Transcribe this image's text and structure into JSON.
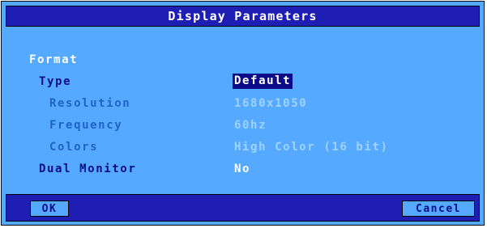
{
  "dialog": {
    "title": "Display Parameters"
  },
  "section": {
    "heading": "Format"
  },
  "fields": {
    "type": {
      "label": "Type",
      "value": "Default"
    },
    "resolution": {
      "label": "Resolution",
      "value": "1680x1050"
    },
    "frequency": {
      "label": "Frequency",
      "value": "60hz"
    },
    "colors": {
      "label": "Colors",
      "value": "High Color (16 bit)"
    },
    "dual_monitor": {
      "label": "Dual Monitor",
      "value": "No"
    }
  },
  "buttons": {
    "ok": "OK",
    "cancel": "Cancel"
  },
  "colors": {
    "dialog_background": "#55aaff",
    "bar_background": "#1e1eb4",
    "selected_background": "#0c0c8a",
    "active_label": "#0c0c8a",
    "dim_label": "#1f63c4",
    "dim_value": "#9ed2ff"
  }
}
